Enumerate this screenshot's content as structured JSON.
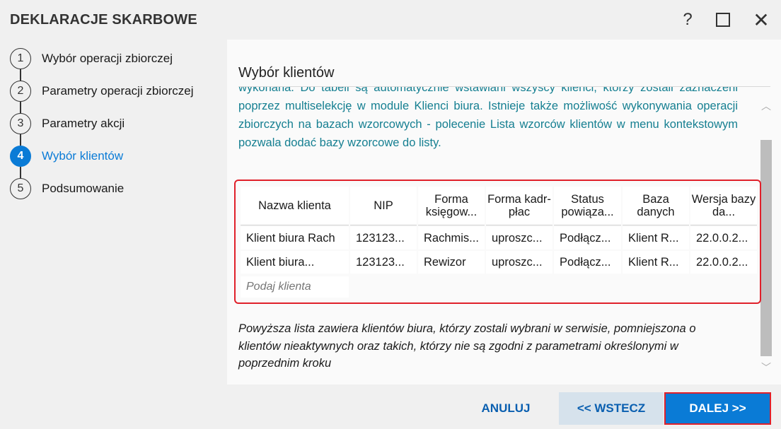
{
  "window": {
    "title": "DEKLARACJE SKARBOWE",
    "help_label": "?",
    "close_label": "✕"
  },
  "steps": [
    {
      "number": "1",
      "label": "Wybór operacji zbiorczej",
      "active": false
    },
    {
      "number": "2",
      "label": "Parametry operacji zbiorczej",
      "active": false
    },
    {
      "number": "3",
      "label": "Parametry akcji",
      "active": false
    },
    {
      "number": "4",
      "label": "Wybór klientów",
      "active": true
    },
    {
      "number": "5",
      "label": "Podsumowanie",
      "active": false
    }
  ],
  "panel": {
    "heading": "Wybór klientów",
    "info_text": "wykonana. Do tabeli są automatycznie wstawiani wszyscy klienci, którzy zostali zaznaczeni poprzez multiselekcję w module Klienci biura. Istnieje także możliwość wykonywania operacji zbiorczych na bazach wzorcowych - polecenie Lista wzorców klientów w menu kontekstowym pozwala dodać bazy wzorcowe do listy.",
    "note": "Powyższa lista zawiera klientów biura, którzy zostali wybrani w serwisie, pomniejszona o klientów nieaktywnych oraz takich, którzy nie są zgodni z parametrami określonymi w poprzednim kroku"
  },
  "table": {
    "headers": [
      "Nazwa klienta",
      "NIP",
      "Forma księgow...",
      "Forma kadr-płac",
      "Status powiąza...",
      "Baza danych",
      "Wersja bazy da..."
    ],
    "rows": [
      [
        "Klient biura Rach",
        "123123...",
        "Rachmis...",
        "uproszc...",
        "Podłącz...",
        "Klient R...",
        "22.0.0.2..."
      ],
      [
        "Klient biura...",
        "123123...",
        "Rewizor",
        "uproszc...",
        "Podłącz...",
        "Klient R...",
        "22.0.0.2..."
      ]
    ],
    "search_placeholder": "Podaj klienta"
  },
  "footer": {
    "cancel_label": "ANULUJ",
    "back_label": "<< WSTECZ",
    "next_label": "DALEJ >>"
  },
  "colors": {
    "accent": "#0a7bd6",
    "info_text": "#157f91",
    "highlight": "#e0202a"
  }
}
